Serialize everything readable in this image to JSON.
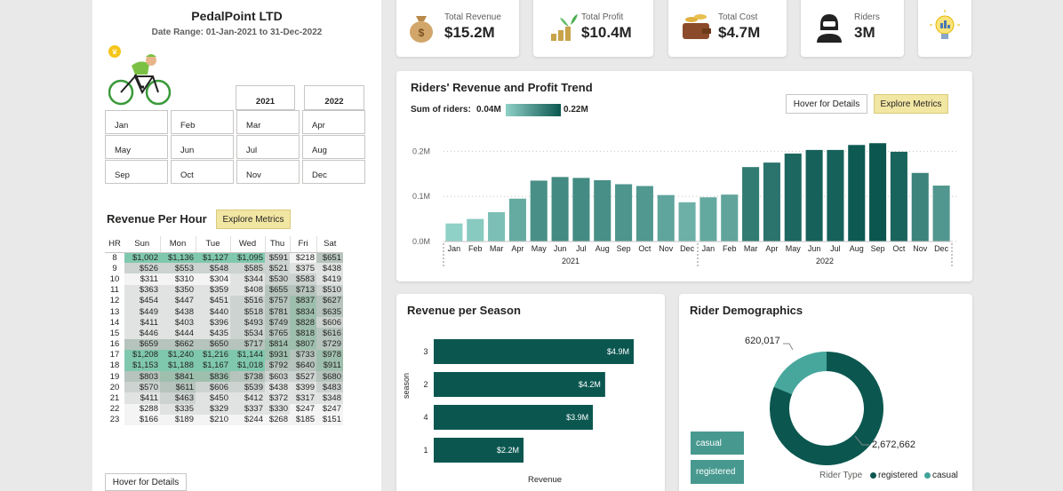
{
  "company": "PedalPoint LTD",
  "date_range": "Date Range: 01-Jan-2021 to 31-Dec-2022",
  "years": [
    "2021",
    "2022"
  ],
  "months": [
    "Jan",
    "Feb",
    "Mar",
    "Apr",
    "May",
    "Jun",
    "Jul",
    "Aug",
    "Sep",
    "Oct",
    "Nov",
    "Dec"
  ],
  "revenue_per_hour": {
    "title": "Revenue Per Hour",
    "explore_label": "Explore Metrics",
    "hover_label": "Hover for Details",
    "columns": [
      "HR",
      "Sun",
      "Mon",
      "Tue",
      "Wed",
      "Thu",
      "Fri",
      "Sat"
    ],
    "rows": [
      {
        "hr": "8",
        "vals": [
          "$1,002",
          "$1,136",
          "$1,127",
          "$1,095",
          "$591",
          "$218",
          "$651"
        ]
      },
      {
        "hr": "9",
        "vals": [
          "$526",
          "$553",
          "$548",
          "$585",
          "$521",
          "$375",
          "$438"
        ]
      },
      {
        "hr": "10",
        "vals": [
          "$311",
          "$310",
          "$304",
          "$344",
          "$530",
          "$583",
          "$419"
        ]
      },
      {
        "hr": "11",
        "vals": [
          "$363",
          "$350",
          "$359",
          "$408",
          "$655",
          "$713",
          "$510"
        ]
      },
      {
        "hr": "12",
        "vals": [
          "$454",
          "$447",
          "$451",
          "$516",
          "$757",
          "$837",
          "$627"
        ]
      },
      {
        "hr": "13",
        "vals": [
          "$449",
          "$438",
          "$440",
          "$518",
          "$781",
          "$834",
          "$635"
        ]
      },
      {
        "hr": "14",
        "vals": [
          "$411",
          "$403",
          "$396",
          "$493",
          "$749",
          "$828",
          "$606"
        ]
      },
      {
        "hr": "15",
        "vals": [
          "$446",
          "$444",
          "$435",
          "$534",
          "$765",
          "$818",
          "$616"
        ]
      },
      {
        "hr": "16",
        "vals": [
          "$659",
          "$662",
          "$650",
          "$717",
          "$814",
          "$807",
          "$729"
        ]
      },
      {
        "hr": "17",
        "vals": [
          "$1,208",
          "$1,240",
          "$1,216",
          "$1,144",
          "$931",
          "$733",
          "$978"
        ]
      },
      {
        "hr": "18",
        "vals": [
          "$1,153",
          "$1,188",
          "$1,167",
          "$1,018",
          "$792",
          "$640",
          "$911"
        ]
      },
      {
        "hr": "19",
        "vals": [
          "$803",
          "$841",
          "$836",
          "$738",
          "$603",
          "$527",
          "$680"
        ]
      },
      {
        "hr": "20",
        "vals": [
          "$570",
          "$611",
          "$606",
          "$539",
          "$438",
          "$399",
          "$483"
        ]
      },
      {
        "hr": "21",
        "vals": [
          "$411",
          "$463",
          "$450",
          "$412",
          "$372",
          "$317",
          "$348"
        ]
      },
      {
        "hr": "22",
        "vals": [
          "$288",
          "$335",
          "$329",
          "$337",
          "$330",
          "$247",
          "$247"
        ]
      },
      {
        "hr": "23",
        "vals": [
          "$166",
          "$189",
          "$210",
          "$244",
          "$268",
          "$185",
          "$151"
        ]
      }
    ]
  },
  "kpis": [
    {
      "label": "Total Revenue",
      "value": "$15.2M",
      "icon": "money-bag-icon"
    },
    {
      "label": "Total Profit",
      "value": "$10.4M",
      "icon": "profit-plant-icon"
    },
    {
      "label": "Total Cost",
      "value": "$4.7M",
      "icon": "cost-wallet-icon"
    },
    {
      "label": "Riders",
      "value": "3M",
      "icon": "rider-helmet-icon"
    }
  ],
  "trend": {
    "title": "Riders' Revenue and Profit Trend",
    "legend_title": "Sum of riders:",
    "legend_min": "0.04M",
    "legend_max": "0.22M",
    "hover_label": "Hover for Details",
    "explore_label": "Explore Metrics",
    "y_ticks": [
      "0.2M",
      "0.1M",
      "0.0M"
    ]
  },
  "season": {
    "title": "Revenue per Season",
    "ylabel": "season",
    "xlabel": "Revenue"
  },
  "demographics": {
    "title": "Rider Demographics",
    "registered_value": "2,672,662",
    "casual_value": "620,017",
    "legend_title": "Rider Type",
    "buttons": [
      "casual",
      "registered"
    ]
  },
  "colors": {
    "accent_dark": "#0b5750",
    "accent_mid": "#3e8f86",
    "accent_light": "#8fd0c7",
    "explore_bg": "#f2e6a3"
  },
  "chart_data": [
    {
      "type": "bar",
      "title": "Riders' Revenue and Profit Trend",
      "categories": [
        "Jan 2021",
        "Feb 2021",
        "Mar 2021",
        "Apr 2021",
        "May 2021",
        "Jun 2021",
        "Jul 2021",
        "Aug 2021",
        "Sep 2021",
        "Oct 2021",
        "Nov 2021",
        "Dec 2021",
        "Jan 2022",
        "Feb 2022",
        "Mar 2022",
        "Apr 2022",
        "May 2022",
        "Jun 2022",
        "Jul 2022",
        "Aug 2022",
        "Sep 2022",
        "Oct 2022",
        "Nov 2022",
        "Dec 2022"
      ],
      "values": [
        0.04,
        0.05,
        0.065,
        0.095,
        0.135,
        0.143,
        0.141,
        0.136,
        0.127,
        0.123,
        0.103,
        0.087,
        0.098,
        0.104,
        0.165,
        0.175,
        0.195,
        0.203,
        0.203,
        0.214,
        0.218,
        0.199,
        0.152,
        0.124
      ],
      "ylim": [
        0,
        0.25
      ],
      "y_unit": "M riders"
    },
    {
      "type": "bar",
      "orientation": "horizontal",
      "title": "Revenue per Season",
      "categories": [
        "3",
        "2",
        "4",
        "1"
      ],
      "values": [
        4.9,
        4.2,
        3.9,
        2.2
      ],
      "labels": [
        "$4.9M",
        "$4.2M",
        "$3.9M",
        "$2.2M"
      ],
      "xlabel": "Revenue",
      "ylabel": "season"
    },
    {
      "type": "pie",
      "title": "Rider Demographics",
      "categories": [
        "registered",
        "casual"
      ],
      "values": [
        2672662,
        620017
      ]
    }
  ]
}
